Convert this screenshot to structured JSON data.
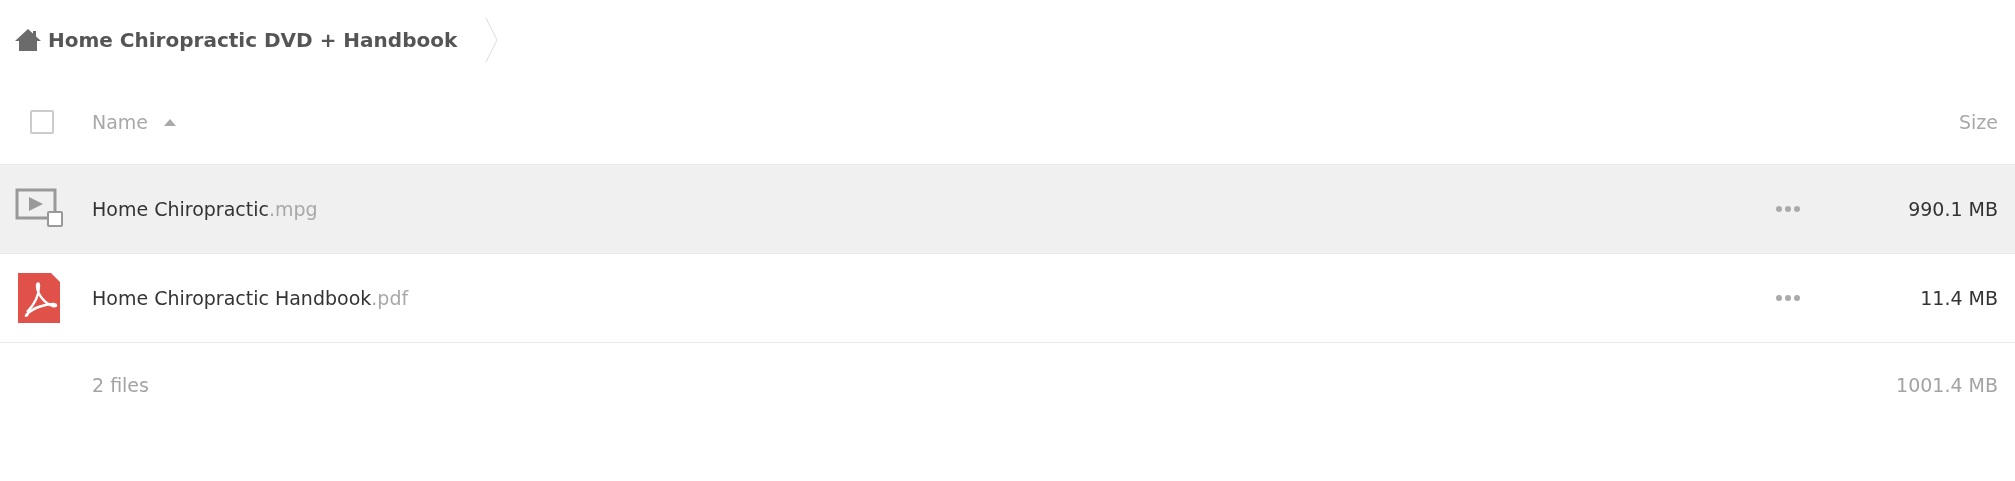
{
  "breadcrumb": {
    "title": "Home Chiropractic DVD + Handbook"
  },
  "table": {
    "select_all": {
      "checked": false
    },
    "columns": [
      {
        "label": "Name",
        "sorted": true
      },
      {
        "label": "Size"
      }
    ],
    "rows": [
      {
        "kind": "video",
        "name": "Home Chiropractic",
        "extension": ".mpg",
        "size": "990.1 MB",
        "highlighted": true
      },
      {
        "kind": "pdf",
        "name": "Home Chiropractic Handbook",
        "extension": ".pdf",
        "size": "11.4 MB",
        "highlighted": false
      }
    ],
    "summary": {
      "count": "2 files",
      "total": "1001.4 MB"
    }
  }
}
